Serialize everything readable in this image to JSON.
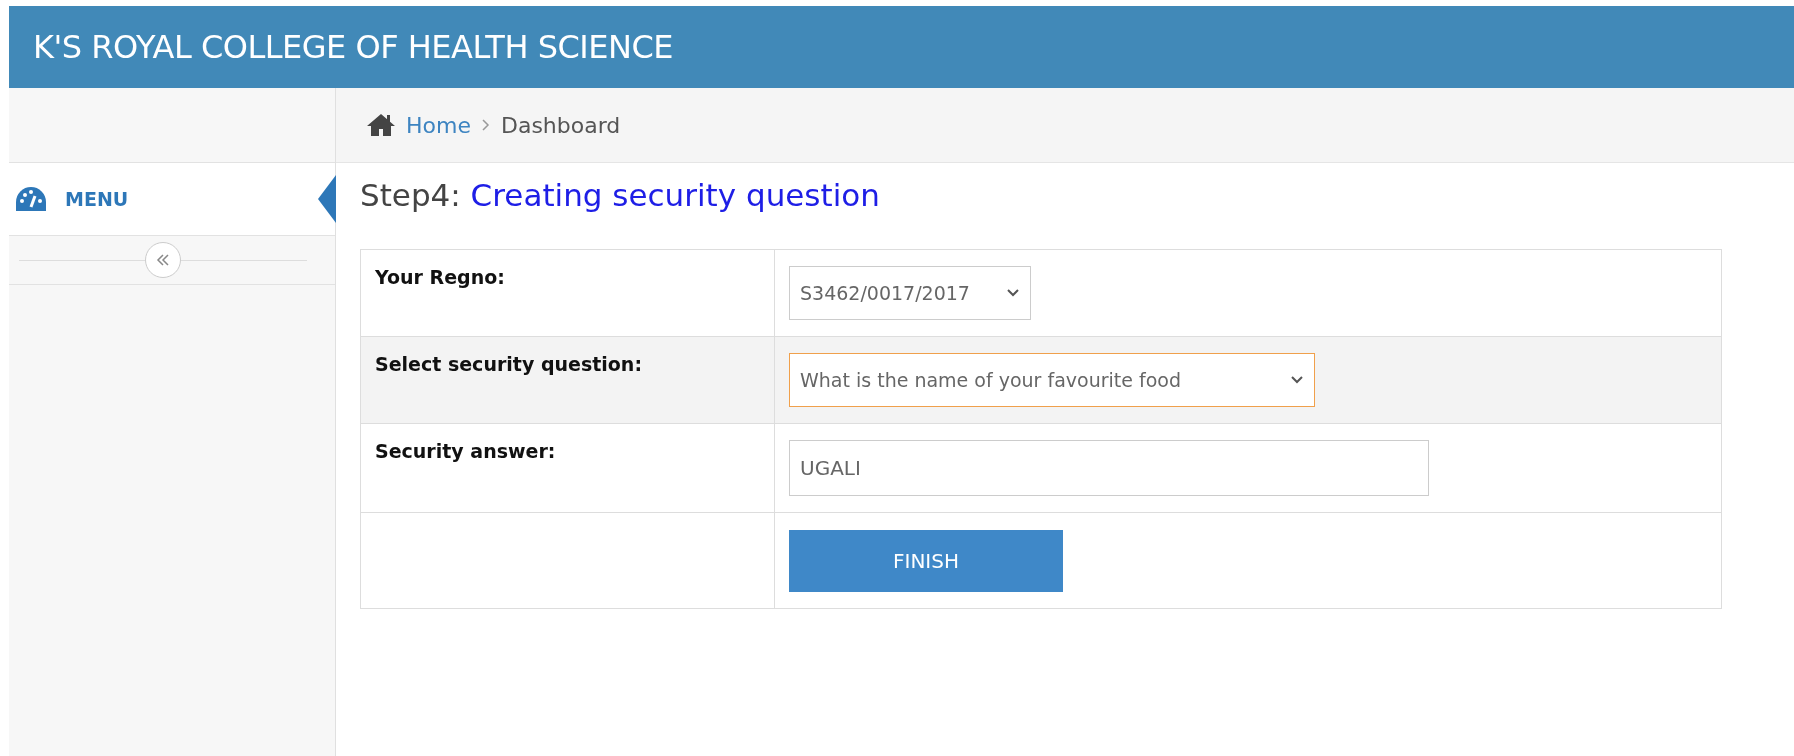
{
  "header": {
    "title": "K'S ROYAL COLLEGE OF HEALTH SCIENCE"
  },
  "breadcrumb": [
    {
      "label": "Home",
      "kind": "link"
    },
    {
      "label": "Dashboard",
      "kind": "current"
    }
  ],
  "sidebar": {
    "menu_label": "MENU",
    "expanded": true
  },
  "page_title": {
    "prefix": "Step4:",
    "title": "Creating security question"
  },
  "form": {
    "rows": [
      {
        "label": "Your Regno:",
        "kind": "select",
        "value": "S3462/0017/2017",
        "focused": false,
        "highlighted": false
      },
      {
        "label": "Select security question:",
        "kind": "select",
        "value": "What is the name of your favourite food",
        "focused": true,
        "highlighted": true
      },
      {
        "label": "Security answer:",
        "kind": "input",
        "value": "UGALI",
        "focused": false,
        "highlighted": false
      },
      {
        "kind": "button",
        "value": "FINISH",
        "highlighted": false
      }
    ]
  }
}
